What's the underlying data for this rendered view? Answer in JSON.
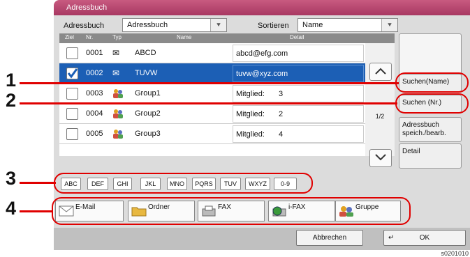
{
  "window": {
    "title": "Adressbuch"
  },
  "filter": {
    "addressbook_label": "Adressbuch",
    "addressbook_value": "Adressbuch",
    "sort_label": "Sortieren",
    "sort_value": "Name"
  },
  "table": {
    "headers": [
      "Ziel",
      "Nr.",
      "Typ",
      "Name",
      "Detail"
    ],
    "rows": [
      {
        "nr": "0001",
        "type_icon": "email-icon",
        "name": "ABCD",
        "detail": "abcd@efg.com",
        "detail_value": "",
        "selected": false
      },
      {
        "nr": "0002",
        "type_icon": "email-icon",
        "name": "TUVW",
        "detail": "tuvw@xyz.com",
        "detail_value": "",
        "selected": true
      },
      {
        "nr": "0003",
        "type_icon": "group-icon",
        "name": "Group1",
        "detail": "Mitglied:",
        "detail_value": "3",
        "selected": false
      },
      {
        "nr": "0004",
        "type_icon": "group-icon",
        "name": "Group2",
        "detail": "Mitglied:",
        "detail_value": "2",
        "selected": false
      },
      {
        "nr": "0005",
        "type_icon": "group-icon",
        "name": "Group3",
        "detail": "Mitglied:",
        "detail_value": "4",
        "selected": false
      }
    ],
    "page": "1/2"
  },
  "side_buttons": {
    "search_name": "Suchen(Name)",
    "search_nr": "Suchen (Nr.)",
    "addressbook_edit": "Adressbuch speich./bearb.",
    "detail": "Detail"
  },
  "alpha_index": [
    "ABC",
    "DEF",
    "GHI",
    "JKL",
    "MNO",
    "PQRS",
    "TUV",
    "WXYZ",
    "0-9"
  ],
  "destinations": [
    {
      "label": "E-Mail",
      "icon": "email-icon"
    },
    {
      "label": "Ordner",
      "icon": "folder-icon"
    },
    {
      "label": "FAX",
      "icon": "fax-icon"
    },
    {
      "label": "i-FAX",
      "icon": "ifax-icon"
    },
    {
      "label": "Gruppe",
      "icon": "group-icon"
    }
  ],
  "footer": {
    "cancel": "Abbrechen",
    "ok": "OK"
  },
  "callouts": [
    "1",
    "2",
    "3",
    "4"
  ],
  "figure_code": "s0201010",
  "colors": {
    "title_bar": "#b0426b",
    "selection": "#1c5fb5",
    "callout": "#e00000"
  }
}
